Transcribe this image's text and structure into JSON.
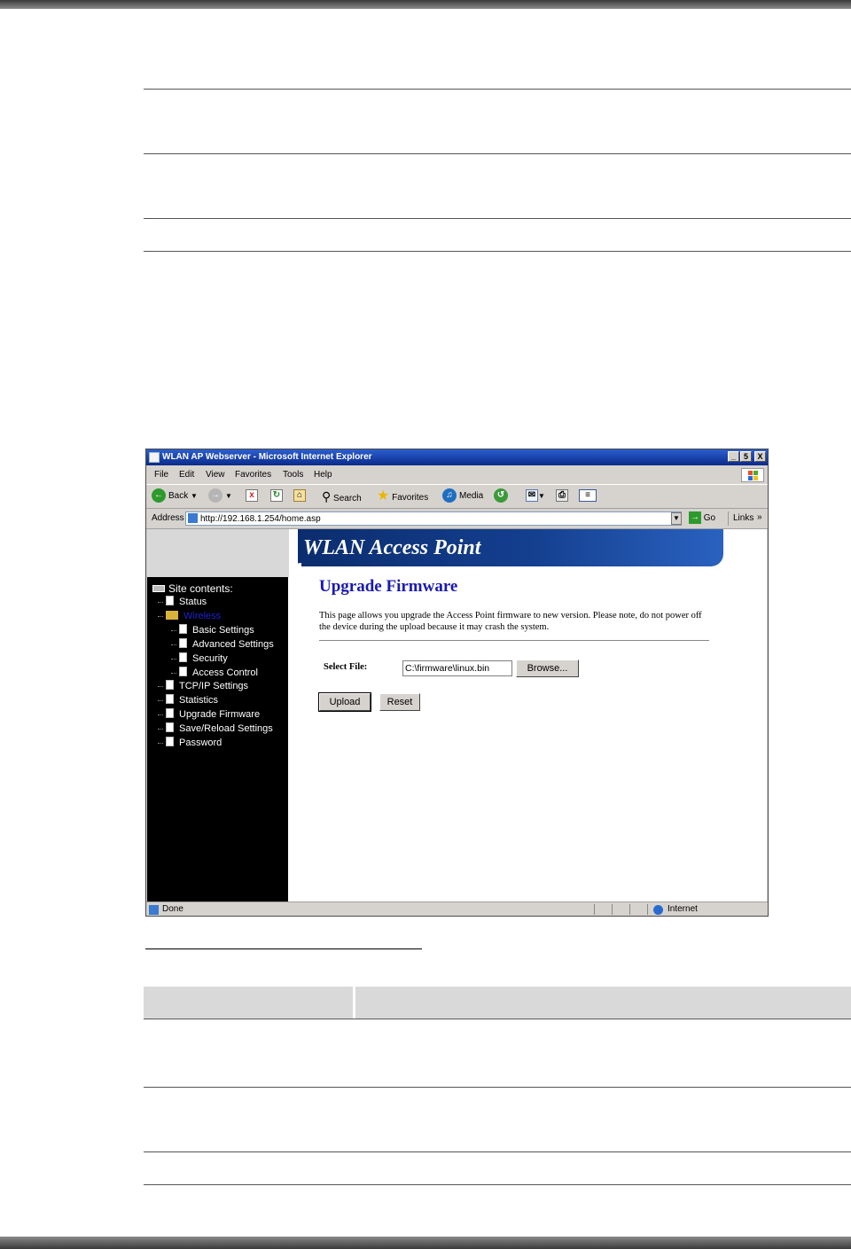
{
  "browser": {
    "title": "WLAN AP Webserver - Microsoft Internet Explorer",
    "window_buttons": [
      "_",
      "5",
      "X"
    ],
    "menu": [
      "File",
      "Edit",
      "View",
      "Favorites",
      "Tools",
      "Help"
    ],
    "toolbar": {
      "back": "Back",
      "search": "Search",
      "favorites": "Favorites",
      "media": "Media"
    },
    "address_label": "Address",
    "address_url": "http://192.168.1.254/home.asp",
    "go": "Go",
    "links": "Links",
    "links_chevron": "»",
    "status_text": "Done",
    "zone": "Internet"
  },
  "banner_title": "WLAN Access Point",
  "sidebar": {
    "header": "Site contents:",
    "items": [
      "Status",
      "Wireless",
      "Basic Settings",
      "Advanced Settings",
      "Security",
      "Access Control",
      "TCP/IP Settings",
      "Statistics",
      "Upgrade Firmware",
      "Save/Reload Settings",
      "Password"
    ]
  },
  "page": {
    "heading": "Upgrade Firmware",
    "description": "This page allows you upgrade the Access Point firmware to new version. Please note, do not power off the device during the upload because it may crash the system.",
    "select_file_label": "Select File:",
    "file_value": "C:\\firmware\\linux.bin",
    "browse": "Browse...",
    "upload": "Upload",
    "reset": "Reset"
  },
  "colors": {
    "heading": "#1a1ab0",
    "active_sidebar_item": "#2020d0",
    "banner": "#143f8f"
  }
}
